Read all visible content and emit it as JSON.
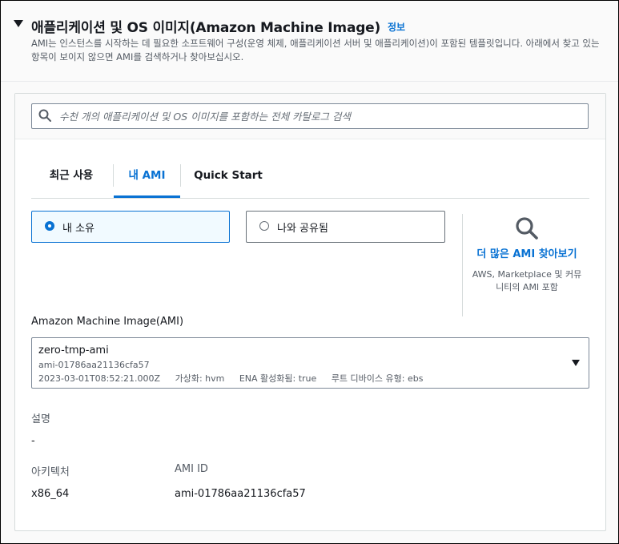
{
  "section": {
    "title": "애플리케이션 및 OS 이미지(Amazon Machine Image)",
    "info_link": "정보",
    "description": "AMI는 인스턴스를 시작하는 데 필요한 소프트웨어 구성(운영 체제, 애플리케이션 서버 및 애플리케이션)이 포함된 템플릿입니다. 아래에서 찾고 있는 항목이 보이지 않으면 AMI를 검색하거나 찾아보십시오."
  },
  "search": {
    "placeholder": "수천 개의 애플리케이션 및 OS 이미지를 포함하는 전체 카탈로그 검색",
    "value": ""
  },
  "tabs": [
    {
      "label": "최근 사용",
      "active": false
    },
    {
      "label": "내 AMI",
      "active": true
    },
    {
      "label": "Quick Start",
      "active": false
    }
  ],
  "ownership": {
    "options": [
      {
        "label": "내 소유",
        "selected": true
      },
      {
        "label": "나와 공유됨",
        "selected": false
      }
    ]
  },
  "more_amis": {
    "link": "더 많은 AMI 찾아보기",
    "subtitle": "AWS, Marketplace 및 커뮤니티의 AMI 포함"
  },
  "ami": {
    "label": "Amazon Machine Image(AMI)",
    "name": "zero-tmp-ami",
    "id": "ami-01786aa21136cfa57",
    "date": "2023-03-01T08:52:21.000Z",
    "virtualization": "가상화: hvm",
    "ena": "ENA 활성화됨: true",
    "root_device": "루트 디바이스 유형: ebs"
  },
  "details": {
    "description_label": "설명",
    "description_value": "-",
    "arch_label": "아키텍처",
    "arch_value": "x86_64",
    "ami_id_label": "AMI ID",
    "ami_id_value": "ami-01786aa21136cfa57"
  },
  "colors": {
    "accent": "#0972d3",
    "selected_bg": "#f1faff",
    "border": "#7d8998",
    "muted_text": "#545b64"
  },
  "icons": [
    "caret-down-icon",
    "search-icon",
    "magnifier-icon",
    "dropdown-caret-icon"
  ]
}
